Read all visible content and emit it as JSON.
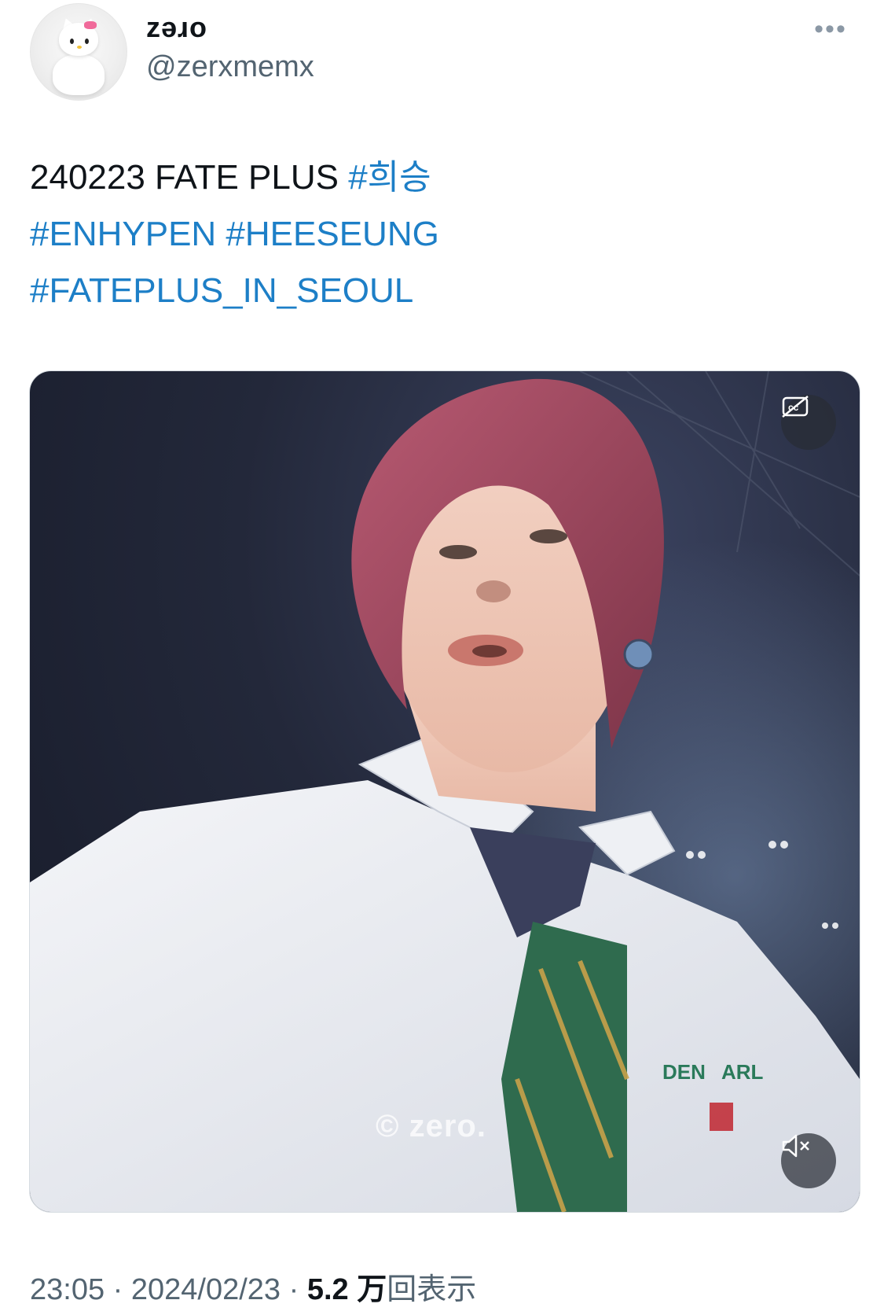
{
  "author": {
    "display_name": "zəɹo",
    "handle": "@zerxmemx"
  },
  "tweet": {
    "line1_text": "240223 FATE PLUS ",
    "line1_hashtag": "#희승",
    "line2_hashtag_1": "#ENHYPEN",
    "line2_hashtag_2": "#HEESEUNG",
    "line3_hashtag": "#FATEPLUS_IN_SEOUL"
  },
  "media": {
    "watermark": "© zero.",
    "shirt_text_1": "DEN",
    "shirt_text_2": "ARL",
    "cc_icon": "captions-off-icon",
    "mute_icon": "volume-muted-icon"
  },
  "footer": {
    "time": "23:05",
    "separator": " · ",
    "date": "2024/02/23",
    "views_count": "5.2 万",
    "views_label": "回表示"
  },
  "colors": {
    "hashtag": "#1d7fc7",
    "secondary_text": "#536471"
  }
}
